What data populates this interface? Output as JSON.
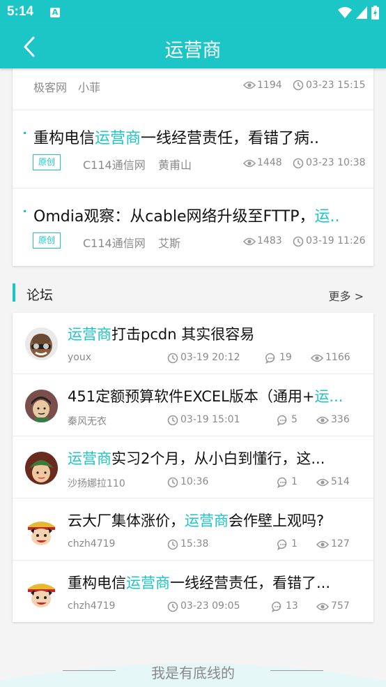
{
  "status_bar": {
    "time": "5:14",
    "notif_icon": "A"
  },
  "app_bar": {
    "title": "运营商",
    "back_icon": "chevron-left"
  },
  "news": {
    "items": [
      {
        "title_pre": "",
        "title_hl": "",
        "title_post": "",
        "tag": "",
        "source": "极客网",
        "author": "小菲",
        "views": "1194",
        "date": "03-23 15:15"
      },
      {
        "title_pre": "重构电信",
        "title_hl": "运营商",
        "title_post": "一线经营责任，看错了病..",
        "tag": "原创",
        "source": "C114通信网",
        "author": "黄甫山",
        "views": "1448",
        "date": "03-23 10:38"
      },
      {
        "title_pre": "Omdia观察：从cable网络升级至FTTP，",
        "title_hl": "运..",
        "title_post": "",
        "tag": "原创",
        "source": "C114通信网",
        "author": "艾斯",
        "views": "1483",
        "date": "03-19 11:26"
      }
    ]
  },
  "forum": {
    "title": "论坛",
    "more": "更多 >",
    "items": [
      {
        "title_pre": "",
        "title_hl": "运营商",
        "title_post": "打击pcdn 其实很容易",
        "user": "youx",
        "time": "03-19 20:12",
        "replies": "19",
        "views": "1166",
        "avatar": "bald-man-avatar"
      },
      {
        "title_pre": "451定额预算软件EXCEL版本（通用+",
        "title_hl": "运...",
        "title_post": "",
        "user": "秦风无衣",
        "time": "03-19 15:01",
        "replies": "5",
        "views": "336",
        "avatar": "cartoon-face-avatar"
      },
      {
        "title_pre": "",
        "title_hl": "运营商",
        "title_post": "实习2个月，从小白到懂行，这...",
        "user": "沙扬娜拉110",
        "time": "10:36",
        "replies": "1",
        "views": "514",
        "avatar": "green-hat-avatar"
      },
      {
        "title_pre": "云大厂集体涨价，",
        "title_hl": "运营商",
        "title_post": "会作壁上观吗?",
        "user": "chzh4719",
        "time": "15:38",
        "replies": "1",
        "views": "127",
        "avatar": "anime-pirate-avatar"
      },
      {
        "title_pre": "重构电信",
        "title_hl": "运营商",
        "title_post": "一线经营责任，看错了...",
        "user": "chzh4719",
        "time": "03-23 09:05",
        "replies": "13",
        "views": "757",
        "avatar": "anime-pirate-avatar"
      }
    ]
  },
  "footer": {
    "text": "我是有底线的"
  },
  "colors": {
    "accent": "#1cc6c6"
  }
}
